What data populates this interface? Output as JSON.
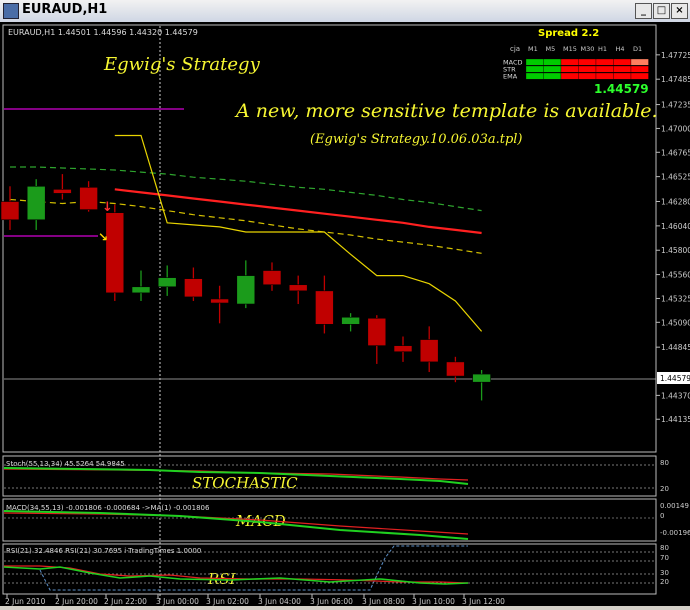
{
  "window": {
    "title": "EURAUD,H1",
    "buttons": {
      "minimize": "_",
      "maximize": "□",
      "close": "×"
    }
  },
  "chart_header": "EURAUD,H1  1.44501 1.44596 1.44320 1.44579",
  "annotations": {
    "strategy": "Egwig's Strategy",
    "notice": "A new, more sensitive template is available.",
    "template": "(Egwig's Strategy.10.06.03a.tpl)",
    "stochastic": "STOCHASTIC",
    "macd": "MACD",
    "rsi": "RSI"
  },
  "panel": {
    "spread": "Spread 2.2",
    "symbol": "cja",
    "timeframes": [
      "M1",
      "M5",
      "M15",
      "M30",
      "H1",
      "H4",
      "D1"
    ],
    "rows": [
      {
        "label": "MACD",
        "colors": [
          "#00cc00",
          "#00cc00",
          "#ff0000",
          "#ff0000",
          "#ff0000",
          "#ff0000",
          "#ff8060"
        ]
      },
      {
        "label": "STR",
        "colors": [
          "#00cc00",
          "#00cc00",
          "#ff0000",
          "#ff0000",
          "#ff0000",
          "#ff0000",
          "#ff0000"
        ]
      },
      {
        "label": "EMA",
        "colors": [
          "#00cc00",
          "#00cc00",
          "#ff0000",
          "#ff0000",
          "#ff0000",
          "#ff0000",
          "#ff0000"
        ]
      }
    ],
    "price": "1.44579"
  },
  "indicators": {
    "stoch": "Stoch(55,13,34) 45.5264 54.9845",
    "macd": "MACD(34,55,13) -0.001806 -0.000684 ->MA(1) -0.001806",
    "rsi": "RSI(21) 32.4846  RSI(21) 30.7695  i-TradingTimes 1.0000"
  },
  "colors": {
    "bull": "#1b9b1b",
    "bear": "#c00000",
    "ma": "#ff2020",
    "band": "#2ea52e",
    "signal": "#e8d400",
    "current_price_bg": "#ffffff"
  },
  "chart_data": {
    "type": "candlestick",
    "symbol": "EURAUD",
    "timeframe": "H1",
    "current_price": 1.44579,
    "price_axis": [
      "1.47725",
      "1.47485",
      "1.47235",
      "1.47000",
      "1.46765",
      "1.46525",
      "1.46280",
      "1.46040",
      "1.45800",
      "1.45560",
      "1.45325",
      "1.45090",
      "1.44845",
      "1.44579",
      "1.44370",
      "1.44135"
    ],
    "price_range": [
      1.4396,
      1.4795
    ],
    "time_labels": [
      "2 Jun 2010",
      "2 Jun 20:00",
      "2 Jun 22:00",
      "3 Jun 00:00",
      "3 Jun 02:00",
      "3 Jun 04:00",
      "3 Jun 06:00",
      "3 Jun 08:00",
      "3 Jun 10:00",
      "3 Jun 12:00"
    ],
    "candles": [
      {
        "o": 1.4628,
        "h": 1.4643,
        "l": 1.46,
        "c": 1.461
      },
      {
        "o": 1.461,
        "h": 1.465,
        "l": 1.46,
        "c": 1.4643
      },
      {
        "o": 1.464,
        "h": 1.4655,
        "l": 1.463,
        "c": 1.4636
      },
      {
        "o": 1.4642,
        "h": 1.4648,
        "l": 1.4618,
        "c": 1.462
      },
      {
        "o": 1.4617,
        "h": 1.4625,
        "l": 1.453,
        "c": 1.4538
      },
      {
        "o": 1.4538,
        "h": 1.456,
        "l": 1.453,
        "c": 1.4544
      },
      {
        "o": 1.4544,
        "h": 1.4565,
        "l": 1.4535,
        "c": 1.4553
      },
      {
        "o": 1.4552,
        "h": 1.4563,
        "l": 1.453,
        "c": 1.4534
      },
      {
        "o": 1.4532,
        "h": 1.4545,
        "l": 1.4508,
        "c": 1.4528
      },
      {
        "o": 1.4527,
        "h": 1.457,
        "l": 1.4523,
        "c": 1.4555
      },
      {
        "o": 1.456,
        "h": 1.4568,
        "l": 1.454,
        "c": 1.4546
      },
      {
        "o": 1.4546,
        "h": 1.4555,
        "l": 1.4527,
        "c": 1.454
      },
      {
        "o": 1.454,
        "h": 1.4555,
        "l": 1.4498,
        "c": 1.4507
      },
      {
        "o": 1.4507,
        "h": 1.4518,
        "l": 1.45,
        "c": 1.4514
      },
      {
        "o": 1.4513,
        "h": 1.4516,
        "l": 1.4468,
        "c": 1.4486
      },
      {
        "o": 1.4486,
        "h": 1.4495,
        "l": 1.447,
        "c": 1.448
      },
      {
        "o": 1.4492,
        "h": 1.4505,
        "l": 1.446,
        "c": 1.447
      },
      {
        "o": 1.447,
        "h": 1.4475,
        "l": 1.445,
        "c": 1.4456
      },
      {
        "o": 1.445,
        "h": 1.4462,
        "l": 1.4432,
        "c": 1.4458
      }
    ],
    "ma_red": [
      null,
      null,
      null,
      null,
      1.464,
      1.4637,
      1.4634,
      1.4631,
      1.4628,
      1.4625,
      1.4622,
      1.4619,
      1.4616,
      1.4613,
      1.461,
      1.4607,
      1.4603,
      1.46,
      1.4597
    ],
    "band_upper": [
      1.4662,
      1.4662,
      1.4661,
      1.466,
      1.4659,
      1.4657,
      1.4655,
      1.4652,
      1.465,
      1.4648,
      1.4645,
      1.4642,
      1.464,
      1.4637,
      1.4634,
      1.463,
      1.4627,
      1.4623,
      1.4619
    ],
    "band_lower": [
      1.463,
      1.4628,
      1.4626,
      1.4628,
      1.4626,
      1.4623,
      1.4619,
      1.4615,
      1.4612,
      1.4609,
      1.4605,
      1.4601,
      1.4598,
      1.4595,
      1.4591,
      1.4588,
      1.4585,
      1.4581,
      1.4577
    ],
    "signal_line": [
      null,
      null,
      null,
      null,
      1.4693,
      1.4693,
      1.4607,
      1.4605,
      1.4603,
      1.4598,
      1.4598,
      1.4598,
      1.4598,
      1.4576,
      1.4555,
      1.4555,
      1.4547,
      1.453,
      1.45
    ]
  }
}
